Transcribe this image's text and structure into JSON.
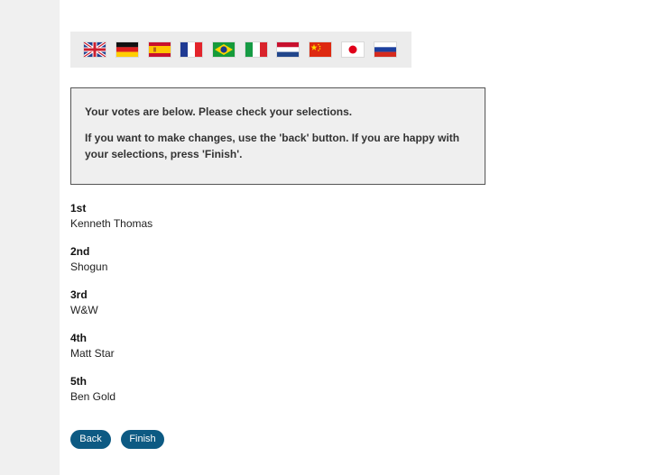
{
  "languages": [
    {
      "name": "english",
      "icon": "uk-flag-icon"
    },
    {
      "name": "german",
      "icon": "germany-flag-icon"
    },
    {
      "name": "spanish",
      "icon": "spain-flag-icon"
    },
    {
      "name": "french",
      "icon": "france-flag-icon"
    },
    {
      "name": "portuguese",
      "icon": "brazil-flag-icon"
    },
    {
      "name": "italian",
      "icon": "italy-flag-icon"
    },
    {
      "name": "dutch",
      "icon": "netherlands-flag-icon"
    },
    {
      "name": "chinese",
      "icon": "china-flag-icon"
    },
    {
      "name": "japanese",
      "icon": "japan-flag-icon"
    },
    {
      "name": "russian",
      "icon": "russia-flag-icon"
    }
  ],
  "notice": {
    "line1": "Your votes are below. Please check your selections.",
    "line2": "If you want to make changes, use the 'back' button. If you are happy with your selections, press 'Finish'."
  },
  "votes": [
    {
      "rank": "1st",
      "name": "Kenneth Thomas"
    },
    {
      "rank": "2nd",
      "name": "Shogun"
    },
    {
      "rank": "3rd",
      "name": "W&W"
    },
    {
      "rank": "4th",
      "name": "Matt Star"
    },
    {
      "rank": "5th",
      "name": "Ben Gold"
    }
  ],
  "buttons": {
    "back": "Back",
    "finish": "Finish"
  },
  "colors": {
    "button": "#0d5a83",
    "notice_bg": "#efefef",
    "lang_bar_bg": "#ececec"
  }
}
